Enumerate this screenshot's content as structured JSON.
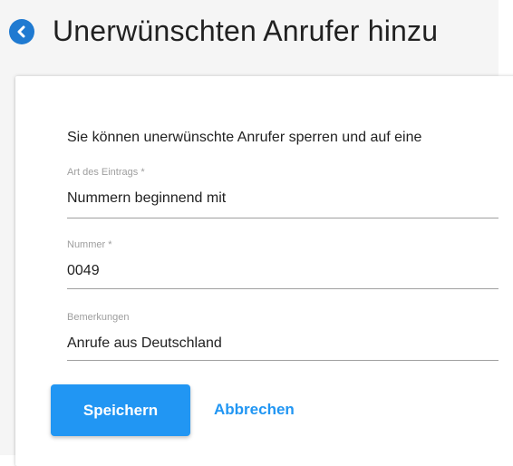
{
  "header": {
    "title": "Unerwünschten Anrufer hinzu",
    "back_icon": "chevron-left-circle-icon"
  },
  "form": {
    "intro": "Sie können unerwünschte Anrufer sperren und auf eine",
    "fields": [
      {
        "label": "Art des Eintrags *",
        "value": "Nummern beginnend mit"
      },
      {
        "label": "Nummer *",
        "value": "0049"
      },
      {
        "label": "Bemerkungen",
        "value": "Anrufe aus Deutschland"
      }
    ]
  },
  "actions": {
    "save_label": "Speichern",
    "cancel_label": "Abbrechen"
  },
  "colors": {
    "accent": "#2196f3",
    "back_icon": "#1f7ad1",
    "page_background": "#f5f5f5"
  }
}
